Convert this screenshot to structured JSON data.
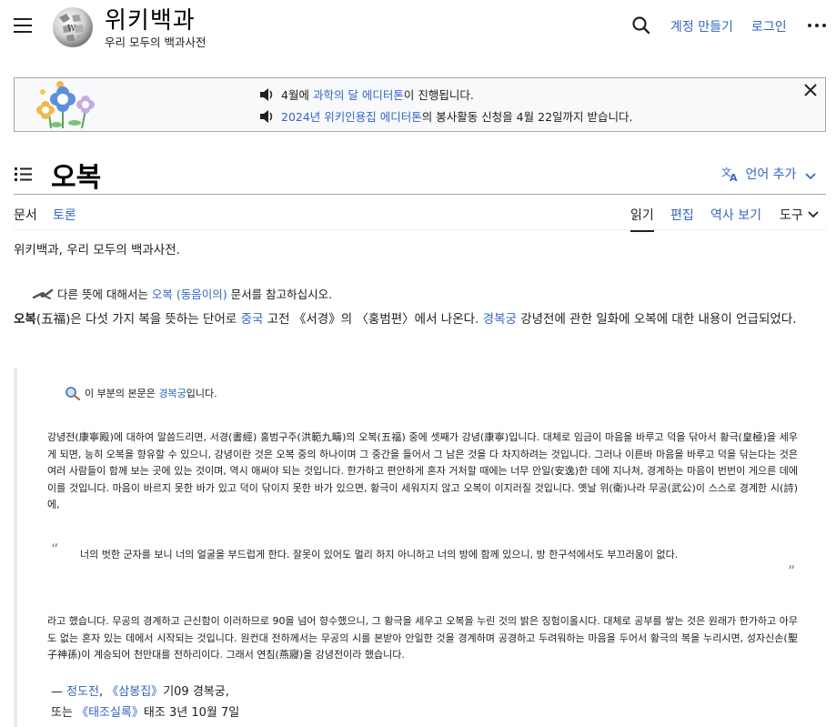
{
  "header": {
    "wordmark": "위키백과",
    "tagline": "우리 모두의 백과사전",
    "create_account": "계정 만들기",
    "login": "로그인"
  },
  "banner": {
    "line1": {
      "pre": "4월에 ",
      "link": "과학의 달 에디터톤",
      "post": "이 진행됩니다."
    },
    "line2": {
      "link": "2024년 위키인용집 에디터톤",
      "post": "의 봉사활동 신청을 4월 22일까지 받습니다."
    }
  },
  "page": {
    "title": "오복",
    "lang_button": "언어 추가"
  },
  "tabs": {
    "article": "문서",
    "talk": "토론",
    "read": "읽기",
    "edit": "편집",
    "history": "역사 보기",
    "tools": "도구"
  },
  "content": {
    "from": "위키백과, 우리 모두의 백과사전.",
    "hatnote": {
      "pre": "다른 뜻에 대해서는 ",
      "link": "오복 (동음이의)",
      "post": " 문서를 참고하십시오."
    },
    "lead": {
      "bold": "오복",
      "t1": "(五福)은 다섯 가지 복을 뜻하는 단어로 ",
      "link1": "중국",
      "t2": " 고전 《서경》의 〈홍범편〉에서 나온다. ",
      "link2": "경복궁",
      "t3": " 강녕전에 관한 일화에 오복에 대한 내용이 언급되었다."
    },
    "main_article": {
      "pre": "이 부분의 본문은 ",
      "link": "경복궁",
      "post": "입니다."
    },
    "para1": "강녕전(康寧殿)에 대하여 말씀드리면, 서경(書經) 홍범구주(洪範九疇)의 오복(五福) 중에 셋째가 강녕(康寧)입니다. 대체로 임금이 마음을 바루고 덕을 닦아서 황극(皇極)을 세우게 되면, 능히 오복을 향유할 수 있으니, 강녕이란 것은 오복 중의 하나이며 그 중간을 들어서 그 남은 것을 다 차지하려는 것입니다. 그러나 이른바 마음을 바루고 덕을 닦는다는 것은 여러 사람들이 함께 보는 곳에 있는 것이며, 역시 애써야 되는 것입니다. 한가하고 편안하게 혼자 거처할 때에는 너무 안일(安逸)한 데에 지나쳐, 경계하는 마음이 번번이 게으른 데에 이를 것입니다. 마음이 바르지 못한 바가 있고 덕이 닦이지 못한 바가 있으면, 황극이 세워지지 않고 오복이 이지러질 것입니다. 옛날 위(衛)나라 무공(武公)이 스스로 경계한 시(詩)에,",
    "inner_quote": "너의 벗한 군자를 보니 너의 얼굴을 부드럽게 한다. 잘못이 있어도 멀리 하지 아니하고 너의 방에 함께 있으니, 방 한구석에서도 부끄러움이 없다.",
    "para2": "라고 했습니다. 무공의 경계하고 근신함이 이러하므로 90을 넘어 향수했으니, 그 황극을 세우고 오복을 누린 것의 밝은 징험이올시다. 대체로 공부를 쌓는 것은 원래가 한가하고 아무도 없는 혼자 있는 데에서 시작되는 것입니다. 원컨대 전하께서는 무공의 시를 본받아 안일한 것을 경계하며 공경하고 두려워하는 마음을 두어서 황극의 복을 누리시면, 성자신손(聖子神孫)이 계승되어 천만대를 전하리이다. 그래서 연침(燕寢)을 강녕전이라 했습니다.",
    "attribution1": {
      "dash": "— ",
      "link1": "정도전",
      "mid": ", ",
      "link2": "《삼봉집》",
      "post": "기09 경복궁,"
    },
    "attribution2": {
      "pre": "또는 ",
      "link": "《태조실록》",
      "post": "태조 3년 10월 7일"
    }
  },
  "colors": {
    "link": "#3366cc",
    "text": "#202122",
    "border": "#a2a9b1"
  }
}
